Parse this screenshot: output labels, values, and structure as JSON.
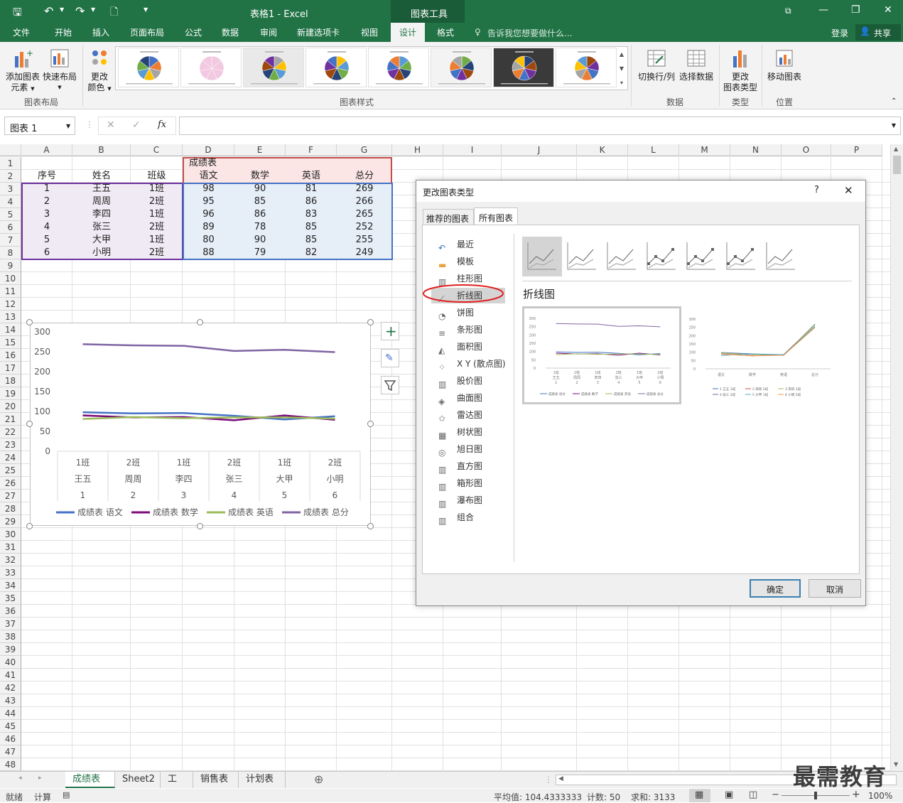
{
  "titlebar": {
    "doc_title": "表格1 - Excel",
    "context_tab": "图表工具"
  },
  "qat": {
    "save": "save-icon",
    "undo": "undo-icon",
    "redo": "redo-icon",
    "new": "new-doc-icon"
  },
  "window": {
    "minimize": "—",
    "restore": "❐",
    "close": "✕"
  },
  "tabs": [
    "文件",
    "开始",
    "插入",
    "页面布局",
    "公式",
    "数据",
    "审阅",
    "新建选项卡",
    "视图",
    "设计",
    "格式"
  ],
  "tell_me": "告诉我您想要做什么...",
  "login": "登录",
  "share": "共享",
  "ribbon": {
    "add_element": "添加图表",
    "add_element2": "元素",
    "quick_layout": "快速布局",
    "change_color": "更改",
    "change_color2": "颜色",
    "group_layout": "图表布局",
    "group_styles": "图表样式",
    "switch_rowcol": "切换行/列",
    "select_data": "选择数据",
    "group_data": "数据",
    "change_type": "更改",
    "change_type2": "图表类型",
    "group_type": "类型",
    "move_chart": "移动图表",
    "group_location": "位置"
  },
  "formula_bar": {
    "name_box": "图表 1",
    "fx": "fx",
    "value": ""
  },
  "columns": [
    "A",
    "B",
    "C",
    "D",
    "E",
    "F",
    "G",
    "H",
    "I",
    "J",
    "K",
    "L",
    "M",
    "N",
    "O",
    "P"
  ],
  "table": {
    "merged_title": "成绩表",
    "headers": [
      "序号",
      "姓名",
      "班级",
      "语文",
      "数学",
      "英语",
      "总分"
    ],
    "rows": [
      [
        "1",
        "王五",
        "1班",
        "98",
        "90",
        "81",
        "269"
      ],
      [
        "2",
        "周周",
        "2班",
        "95",
        "85",
        "86",
        "266"
      ],
      [
        "3",
        "李四",
        "1班",
        "96",
        "86",
        "83",
        "265"
      ],
      [
        "4",
        "张三",
        "2班",
        "89",
        "78",
        "85",
        "252"
      ],
      [
        "5",
        "大甲",
        "1班",
        "80",
        "90",
        "85",
        "255"
      ],
      [
        "6",
        "小明",
        "2班",
        "88",
        "79",
        "82",
        "249"
      ]
    ]
  },
  "chart_data": {
    "type": "line",
    "ylim": [
      0,
      300
    ],
    "yticks": [
      "300",
      "250",
      "200",
      "150",
      "100",
      "50",
      "0"
    ],
    "categories": [
      {
        "class": "1班",
        "name": "王五",
        "id": "1"
      },
      {
        "class": "2班",
        "name": "周周",
        "id": "2"
      },
      {
        "class": "1班",
        "name": "李四",
        "id": "3"
      },
      {
        "class": "2班",
        "name": "张三",
        "id": "4"
      },
      {
        "class": "1班",
        "name": "大甲",
        "id": "5"
      },
      {
        "class": "2班",
        "name": "小明",
        "id": "6"
      }
    ],
    "series": [
      {
        "name": "成绩表 语文",
        "color": "#4472c4",
        "values": [
          98,
          95,
          96,
          89,
          80,
          88
        ]
      },
      {
        "name": "成绩表 数学",
        "color": "#7a0a7a",
        "values": [
          90,
          85,
          86,
          78,
          90,
          79
        ]
      },
      {
        "name": "成绩表 英语",
        "color": "#9bbb59",
        "values": [
          81,
          86,
          83,
          85,
          85,
          82
        ]
      },
      {
        "name": "成绩表 总分",
        "color": "#8064a2",
        "values": [
          269,
          266,
          265,
          252,
          255,
          249
        ]
      }
    ]
  },
  "dialog": {
    "title": "更改图表类型",
    "help": "?",
    "close": "✕",
    "tab_recommended": "推荐的图表",
    "tab_all": "所有图表",
    "categories": [
      "最近",
      "模板",
      "柱形图",
      "折线图",
      "饼图",
      "条形图",
      "面积图",
      "X Y (散点图)",
      "股价图",
      "曲面图",
      "雷达图",
      "树状图",
      "旭日图",
      "直方图",
      "箱形图",
      "瀑布图",
      "组合"
    ],
    "selected_heading": "折线图",
    "ok": "确定",
    "cancel": "取消"
  },
  "sheet_tabs": [
    "成绩表",
    "Sheet2",
    "工资",
    "销售表",
    "计划表"
  ],
  "status": {
    "ready": "就绪",
    "calc": "计算",
    "average": "平均值: 104.4333333",
    "count": "计数: 50",
    "sum": "求和: 3133",
    "zoom": "100%"
  },
  "watermark": "最需教育"
}
